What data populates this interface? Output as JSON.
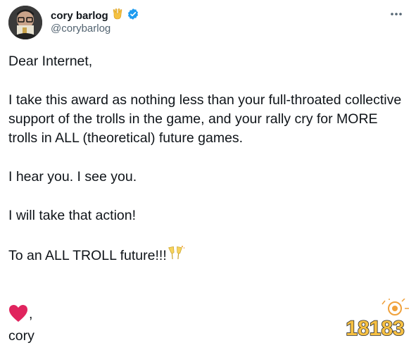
{
  "author": {
    "display_name": "cory barlog",
    "handle": "@corybarlog",
    "verified": true,
    "name_emoji": "vulcan-salute-icon"
  },
  "tweet": {
    "lines": [
      "Dear Internet,",
      "I take this award as nothing less than your full-throated collective support of the trolls in the game, and your rally cry for MORE trolls in ALL (theoretical) future games.",
      "I hear you. I see you.",
      "I will take that action!",
      "To an ALL TROLL future!!!"
    ],
    "toast_emoji": "clinking-glasses-icon",
    "heart_emoji": "red-heart-icon",
    "heart_suffix": ",",
    "signoff": "cory"
  },
  "colors": {
    "text": "#0f1419",
    "secondary": "#536471",
    "verified_blue": "#1d9bf0",
    "heart_red": "#e0245e"
  },
  "watermark": {
    "text": "18183"
  }
}
